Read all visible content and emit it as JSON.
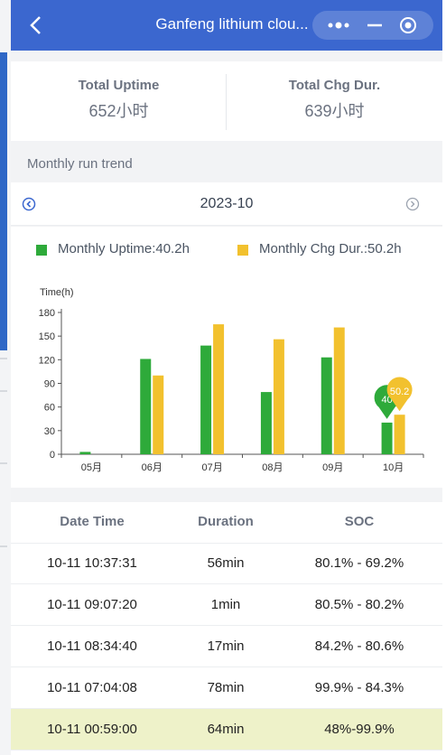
{
  "header": {
    "title": "Ganfeng lithium clou...",
    "back_icon": "back-icon",
    "menu_icon": "more-icon",
    "minimize_icon": "minimize-icon",
    "close_icon": "close-icon"
  },
  "stats": {
    "uptime_label": "Total Uptime",
    "uptime_value": "652小时",
    "charge_label": "Total Chg Dur.",
    "charge_value": "639小时"
  },
  "section_title": "Monthly run trend",
  "month_nav": {
    "label": "2023-10",
    "prev_icon": "prev-month-icon",
    "next_icon": "next-month-icon"
  },
  "legend": {
    "uptime": "Monthly Uptime:40.2h",
    "charge": "Monthly Chg Dur.:50.2h"
  },
  "chart_data": {
    "type": "bar",
    "ylabel": "Time(h)",
    "ylim": [
      0,
      180
    ],
    "yticks": [
      0,
      30,
      60,
      90,
      120,
      150,
      180
    ],
    "categories": [
      "05月",
      "06月",
      "07月",
      "08月",
      "09月",
      "10月"
    ],
    "series": [
      {
        "name": "Monthly Uptime",
        "color": "#2eaa3a",
        "values": [
          3,
          121,
          138,
          79,
          123,
          40.2
        ]
      },
      {
        "name": "Monthly Chg Dur.",
        "color": "#f2c12e",
        "values": [
          0,
          100,
          165,
          146,
          161,
          50.2
        ]
      }
    ],
    "tooltip_labels": [
      "40",
      "50.2"
    ],
    "grid": false
  },
  "table": {
    "headers": [
      "Date Time",
      "Duration",
      "SOC"
    ],
    "rows": [
      [
        "10-11 10:37:31",
        "56min",
        "80.1% - 69.2%"
      ],
      [
        "10-11 09:07:20",
        "1min",
        "80.5% - 80.2%"
      ],
      [
        "10-11 08:34:40",
        "17min",
        "84.2% - 80.6%"
      ],
      [
        "10-11 07:04:08",
        "78min",
        "99.9% - 84.3%"
      ],
      [
        "10-11 00:59:00",
        "64min",
        "48%-99.9%"
      ]
    ]
  },
  "colors": {
    "header": "#3b67cf",
    "uptime": "#2eaa3a",
    "charge": "#f2c12e",
    "highlight_row": "#eef2c9"
  }
}
